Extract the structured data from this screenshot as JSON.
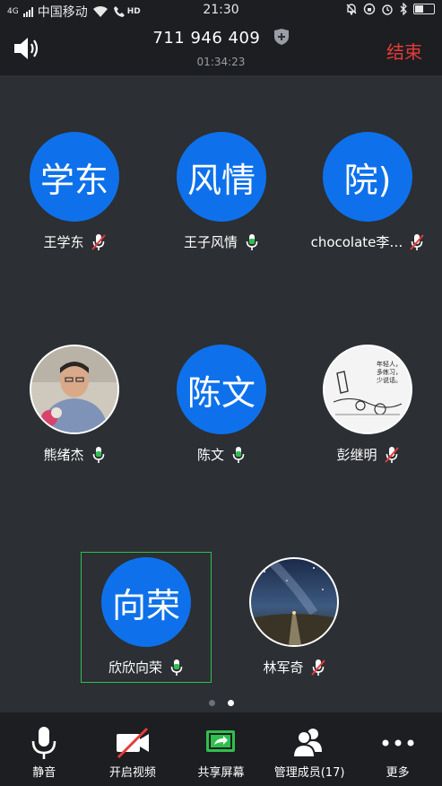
{
  "status_bar": {
    "carrier": "中国移动",
    "network": "4G",
    "hd_label": "HD",
    "time": "21:30"
  },
  "meeting": {
    "id": "711 946 409",
    "elapsed": "01:34:23",
    "end_label": "结束"
  },
  "participants": [
    {
      "name": "王学东",
      "avatar_text": "学东",
      "mic": "muted",
      "avatar": "initials"
    },
    {
      "name": "王子风情",
      "avatar_text": "风情",
      "mic": "active",
      "avatar": "initials"
    },
    {
      "name": "chocolate李…",
      "avatar_text": "院)",
      "mic": "muted",
      "avatar": "initials"
    },
    {
      "name": "熊绪杰",
      "avatar_text": "",
      "mic": "active",
      "avatar": "photo"
    },
    {
      "name": "陈文",
      "avatar_text": "陈文",
      "mic": "active",
      "avatar": "initials"
    },
    {
      "name": "彭继明",
      "avatar_text": "",
      "mic": "muted",
      "avatar": "sketch",
      "photo_caption": [
        "年轻人，",
        "多练习，",
        "少说话。"
      ]
    },
    {
      "name": "欣欣向荣",
      "avatar_text": "向荣",
      "mic": "active",
      "avatar": "initials",
      "speaking": true
    },
    {
      "name": "林军奇",
      "avatar_text": "",
      "mic": "muted",
      "avatar": "night-sky"
    }
  ],
  "pager": {
    "pages": 2,
    "current": 2
  },
  "toolbar": {
    "mute_label": "静音",
    "video_label": "开启视频",
    "share_label": "共享屏幕",
    "participants_label": "管理成员(17)",
    "more_label": "更多"
  },
  "colors": {
    "accent_blue": "#0e71eb",
    "mic_active": "#2fbf4f",
    "mic_muted": "#e63a3a",
    "end": "#e63a3a"
  }
}
